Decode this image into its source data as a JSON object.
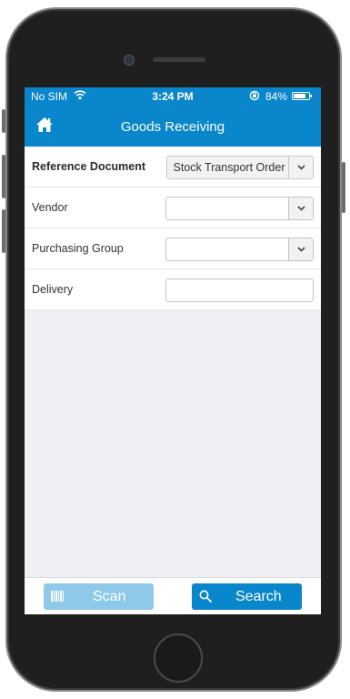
{
  "status_bar": {
    "carrier": "No SIM",
    "time": "3:24 PM",
    "battery": "84%",
    "battery_level": 0.84
  },
  "header": {
    "title": "Goods Receiving"
  },
  "form": {
    "reference_document": {
      "label": "Reference Document",
      "value": "Stock Transport Order"
    },
    "vendor": {
      "label": "Vendor",
      "value": ""
    },
    "purchasing_group": {
      "label": "Purchasing Group",
      "value": ""
    },
    "delivery": {
      "label": "Delivery",
      "value": ""
    }
  },
  "footer": {
    "scan_label": "Scan",
    "search_label": "Search"
  },
  "colors": {
    "brand_blue": "#0a86cc",
    "scan_disabled": "#8ec9ea",
    "background": "#eef0f3"
  },
  "icons": {
    "home": "home-icon",
    "wifi": "wifi-icon",
    "orientation_lock": "orientation-lock-icon",
    "battery": "battery-icon",
    "chevron": "chevron-down-icon",
    "barcode": "barcode-icon",
    "search": "search-icon"
  }
}
